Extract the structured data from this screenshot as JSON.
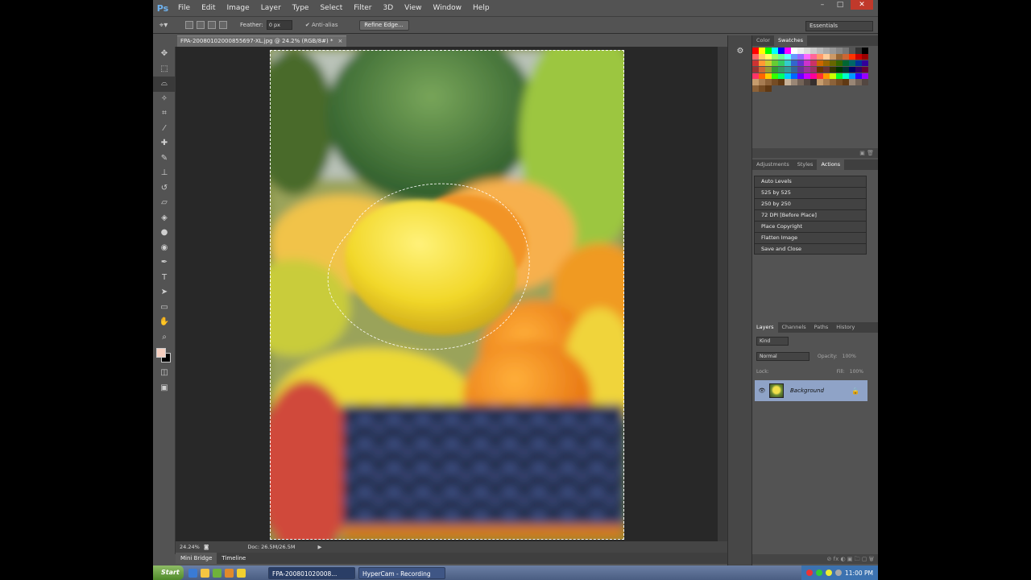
{
  "app": {
    "logo": "Ps"
  },
  "menu": [
    "File",
    "Edit",
    "Image",
    "Layer",
    "Type",
    "Select",
    "Filter",
    "3D",
    "View",
    "Window",
    "Help"
  ],
  "window_controls": [
    "–",
    "□",
    "✕"
  ],
  "options": {
    "feather_label": "Feather:",
    "feather_value": "0 px",
    "antialias_label": "Anti-alias",
    "refine_button": "Refine Edge...",
    "workspace": "Essentials"
  },
  "document": {
    "tab_title": "FPA-20080102000855697-XL.jpg @ 24.2% (RGB/8#) *",
    "zoom": "24.24%",
    "doc_size": "Doc: 26.5M/26.5M"
  },
  "bottom_tabs": [
    "Mini Bridge",
    "Timeline"
  ],
  "panels": {
    "color_tabs": [
      "Color",
      "Swatches"
    ],
    "adjust_tabs": [
      "Adjustments",
      "Styles",
      "Actions"
    ],
    "actions": [
      "Auto Levels",
      "525 by 525",
      "250 by 250",
      "72 DPI [Before Place]",
      "Place Copyright",
      "Flatten Image",
      "Save and Close"
    ],
    "layers_tabs": [
      "Layers",
      "Channels",
      "Paths",
      "History"
    ],
    "layers": {
      "filter_label": "Kind",
      "blend_mode": "Normal",
      "opacity_label": "Opacity:",
      "opacity_value": "100%",
      "lock_label": "Lock:",
      "fill_label": "Fill:",
      "fill_value": "100%",
      "layer_name": "Background"
    }
  },
  "swatch_colors": [
    "#ff0000",
    "#ffff00",
    "#00ff00",
    "#00ffff",
    "#0000ff",
    "#ff00ff",
    "#ffffff",
    "#eeeeee",
    "#dddddd",
    "#cccccc",
    "#bbbbbb",
    "#aaaaaa",
    "#999999",
    "#888888",
    "#777777",
    "#555555",
    "#333333",
    "#000000",
    "#ff6666",
    "#ffcc66",
    "#ffff66",
    "#99ff66",
    "#66ff99",
    "#66ffff",
    "#6699ff",
    "#9966ff",
    "#ff66ff",
    "#ff6699",
    "#ff9966",
    "#ffcc99",
    "#cc9966",
    "#996633",
    "#cc6633",
    "#ff3300",
    "#cc0000",
    "#990000",
    "#cc3333",
    "#ff9933",
    "#cccc33",
    "#66cc33",
    "#33cc66",
    "#33cccc",
    "#3366cc",
    "#6633cc",
    "#cc33cc",
    "#cc3366",
    "#cc6600",
    "#996600",
    "#666600",
    "#336600",
    "#006633",
    "#006666",
    "#003399",
    "#330099",
    "#993333",
    "#cc6633",
    "#999933",
    "#339933",
    "#339966",
    "#339999",
    "#336699",
    "#663399",
    "#993399",
    "#993366",
    "#663300",
    "#663333",
    "#333300",
    "#003300",
    "#003333",
    "#000066",
    "#330066",
    "#660033",
    "#ff3366",
    "#ff6600",
    "#ffcc00",
    "#33ff00",
    "#00ff66",
    "#00ccff",
    "#0066ff",
    "#6600ff",
    "#cc00ff",
    "#ff0099",
    "#ff3333",
    "#ff9900",
    "#ccff00",
    "#00ff33",
    "#00ffcc",
    "#0099ff",
    "#3300ff",
    "#9900ff",
    "#c69c6d",
    "#a67c52",
    "#8c6239",
    "#754c24",
    "#603913",
    "#c7b299",
    "#998675",
    "#736357",
    "#534741",
    "#362f2d",
    "#c69c6d",
    "#a67c52",
    "#8c6239",
    "#754c24",
    "#603913",
    "#998675",
    "#736357",
    "#534741",
    "#8c6239",
    "#754c24",
    "#603913"
  ],
  "taskbar": {
    "start": "Start",
    "tasks": [
      "FPA-200801020008...",
      "HyperCam - Recording"
    ],
    "clock": "11:00 PM"
  }
}
